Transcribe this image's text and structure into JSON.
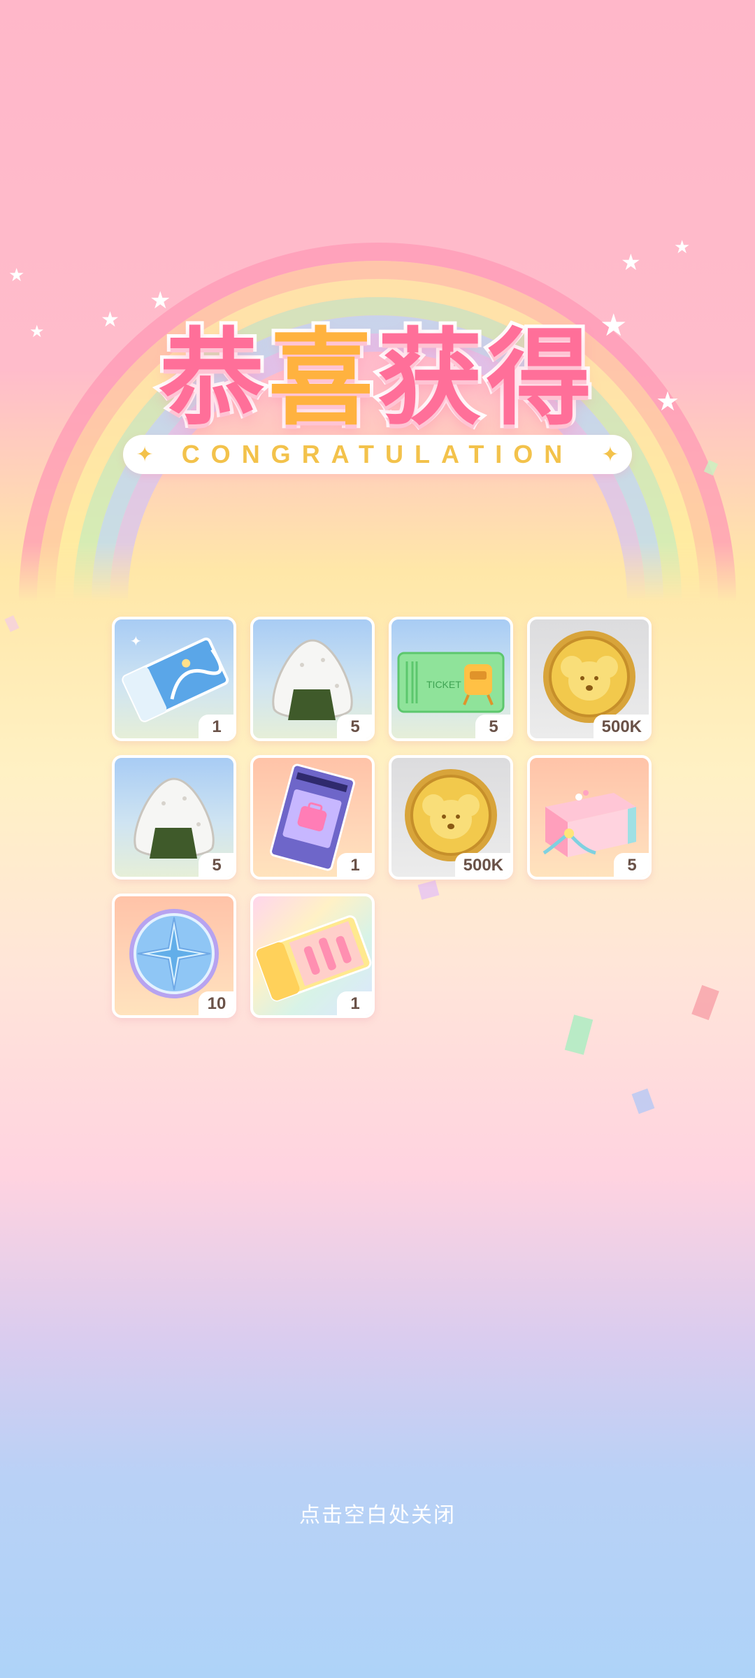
{
  "title_cn": [
    "恭",
    "喜",
    "获",
    "得"
  ],
  "banner": {
    "text": "CONGRATULATION",
    "spark": "✦"
  },
  "rewards": [
    {
      "icon": "blue-ticket-icon",
      "bg": "blue",
      "count": "1"
    },
    {
      "icon": "rice-ball-icon",
      "bg": "blue",
      "count": "5"
    },
    {
      "icon": "green-ticket-icon",
      "bg": "blue",
      "count": "5"
    },
    {
      "icon": "gold-coin-icon",
      "bg": "gray",
      "count": "500K"
    },
    {
      "icon": "rice-ball-icon",
      "bg": "blue",
      "count": "5"
    },
    {
      "icon": "purple-voucher-icon",
      "bg": "orange",
      "count": "1"
    },
    {
      "icon": "gold-coin-icon",
      "bg": "gray",
      "count": "500K"
    },
    {
      "icon": "gift-box-icon",
      "bg": "orange",
      "count": "5"
    },
    {
      "icon": "star-medal-icon",
      "bg": "orange",
      "count": "10"
    },
    {
      "icon": "rainbow-ticket-icon",
      "bg": "rainbow",
      "count": "1"
    }
  ],
  "close_hint": "点击空白处关闭",
  "colors": {
    "title_pink": "#ff6f99",
    "title_yellow": "#ffb23f",
    "banner_text": "#f3c24b"
  }
}
